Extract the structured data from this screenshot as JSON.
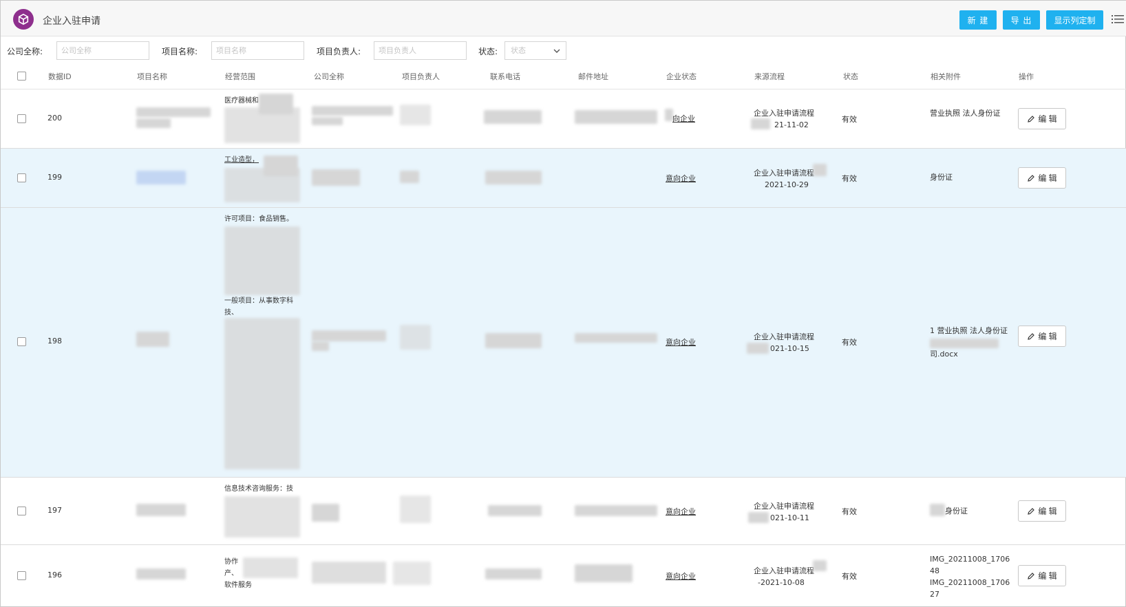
{
  "header": {
    "title": "企业入驻申请",
    "logo_icon": "cube-icon",
    "buttons": {
      "new": "新 建",
      "export": "导 出",
      "columns": "显示列定制"
    },
    "menu_icon": "list-menu-icon",
    "accent_color": "#1fb1ef",
    "logo_color": "#8e2f8d"
  },
  "filters": {
    "company_label": "公司全称:",
    "company_placeholder": "公司全称",
    "project_label": "项目名称:",
    "project_placeholder": "项目名称",
    "owner_label": "项目负责人:",
    "owner_placeholder": "项目负责人",
    "status_label": "状态:",
    "status_placeholder": "状态"
  },
  "table": {
    "columns": [
      "数据ID",
      "项目名称",
      "经营范围",
      "公司全称",
      "项目负责人",
      "联系电话",
      "邮件地址",
      "企业状态",
      "来源流程",
      "状态",
      "相关附件",
      "操作"
    ],
    "edit_label": "编 辑",
    "rows": [
      {
        "id": "200",
        "scope": [
          "医疗器械和",
          "",
          "",
          ""
        ],
        "company_status": "向企业",
        "source_line1": "企业入驻申请流程",
        "source_line2": "21-11-02",
        "status": "有效",
        "attachments": [
          "营业执照 法人身份证"
        ]
      },
      {
        "id": "199",
        "scope": [
          "工业造型，",
          "",
          "",
          ""
        ],
        "company_status": "意向企业",
        "source_line1": "企业入驻申请流程",
        "source_line2": "2021-10-29",
        "status": "有效",
        "attachments": [
          "身份证"
        ]
      },
      {
        "id": "198",
        "scope": [
          "许可项目：食品销售。",
          "一般项目：从事数字科",
          "技、"
        ],
        "company_status": "意向企业",
        "source_line1": "企业入驻申请流程",
        "source_line2": "021-10-15",
        "status": "有效",
        "attachments": [
          "1 营业执照 法人身份证",
          "司.docx"
        ]
      },
      {
        "id": "197",
        "scope": [
          "信息技术咨询服务：技"
        ],
        "company_status": "意向企业",
        "source_line1": "企业入驻申请流程",
        "source_line2": "021-10-11",
        "status": "有效",
        "attachments": [
          "身份证"
        ]
      },
      {
        "id": "196",
        "scope": [
          "协作",
          "产、",
          "软件服务"
        ],
        "company_status": "意向企业",
        "source_line1": "企业入驻申请流程",
        "source_line2": "-2021-10-08",
        "status": "有效",
        "attachments": [
          "IMG_20211008_1706",
          "48",
          "IMG_20211008_1706",
          "27"
        ]
      }
    ]
  }
}
